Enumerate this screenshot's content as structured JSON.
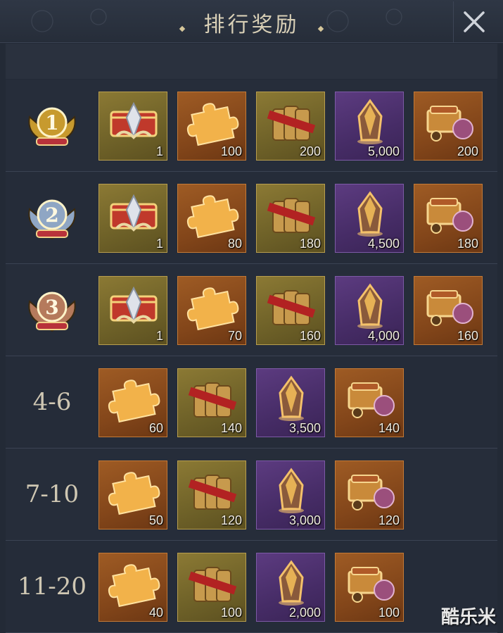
{
  "header": {
    "title": "排行奖励"
  },
  "rows": [
    {
      "rank_label": "1",
      "badge_color": "#c79a2e",
      "items": [
        {
          "icon": "reward-chest-icon",
          "tier": "gold",
          "qty": "1"
        },
        {
          "icon": "puzzle-piece-icon",
          "tier": "orange",
          "qty": "100"
        },
        {
          "icon": "scroll-bundle-icon",
          "tier": "gold",
          "qty": "200"
        },
        {
          "icon": "purple-crystal-icon",
          "tier": "purple",
          "qty": "5,000"
        },
        {
          "icon": "treasure-cart-icon",
          "tier": "orange",
          "qty": "200"
        }
      ]
    },
    {
      "rank_label": "2",
      "badge_color": "#8fa6c4",
      "items": [
        {
          "icon": "reward-chest-icon",
          "tier": "gold",
          "qty": "1"
        },
        {
          "icon": "puzzle-piece-icon",
          "tier": "orange",
          "qty": "80"
        },
        {
          "icon": "scroll-bundle-icon",
          "tier": "gold",
          "qty": "180"
        },
        {
          "icon": "purple-crystal-icon",
          "tier": "purple",
          "qty": "4,500"
        },
        {
          "icon": "treasure-cart-icon",
          "tier": "orange",
          "qty": "180"
        }
      ]
    },
    {
      "rank_label": "3",
      "badge_color": "#b57a5c",
      "items": [
        {
          "icon": "reward-chest-icon",
          "tier": "gold",
          "qty": "1"
        },
        {
          "icon": "puzzle-piece-icon",
          "tier": "orange",
          "qty": "70"
        },
        {
          "icon": "scroll-bundle-icon",
          "tier": "gold",
          "qty": "160"
        },
        {
          "icon": "purple-crystal-icon",
          "tier": "purple",
          "qty": "4,000"
        },
        {
          "icon": "treasure-cart-icon",
          "tier": "orange",
          "qty": "160"
        }
      ]
    },
    {
      "rank_label": "4-6",
      "items": [
        {
          "icon": "puzzle-piece-icon",
          "tier": "orange",
          "qty": "60"
        },
        {
          "icon": "scroll-bundle-icon",
          "tier": "gold",
          "qty": "140"
        },
        {
          "icon": "purple-crystal-icon",
          "tier": "purple",
          "qty": "3,500"
        },
        {
          "icon": "treasure-cart-icon",
          "tier": "orange",
          "qty": "140"
        }
      ]
    },
    {
      "rank_label": "7-10",
      "items": [
        {
          "icon": "puzzle-piece-icon",
          "tier": "orange",
          "qty": "50"
        },
        {
          "icon": "scroll-bundle-icon",
          "tier": "gold",
          "qty": "120"
        },
        {
          "icon": "purple-crystal-icon",
          "tier": "purple",
          "qty": "3,000"
        },
        {
          "icon": "treasure-cart-icon",
          "tier": "orange",
          "qty": "120"
        }
      ]
    },
    {
      "rank_label": "11-20",
      "items": [
        {
          "icon": "puzzle-piece-icon",
          "tier": "orange",
          "qty": "40"
        },
        {
          "icon": "scroll-bundle-icon",
          "tier": "gold",
          "qty": "100"
        },
        {
          "icon": "purple-crystal-icon",
          "tier": "purple",
          "qty": "2,000"
        },
        {
          "icon": "treasure-cart-icon",
          "tier": "orange",
          "qty": "100"
        }
      ]
    }
  ],
  "watermark": "酷乐米"
}
